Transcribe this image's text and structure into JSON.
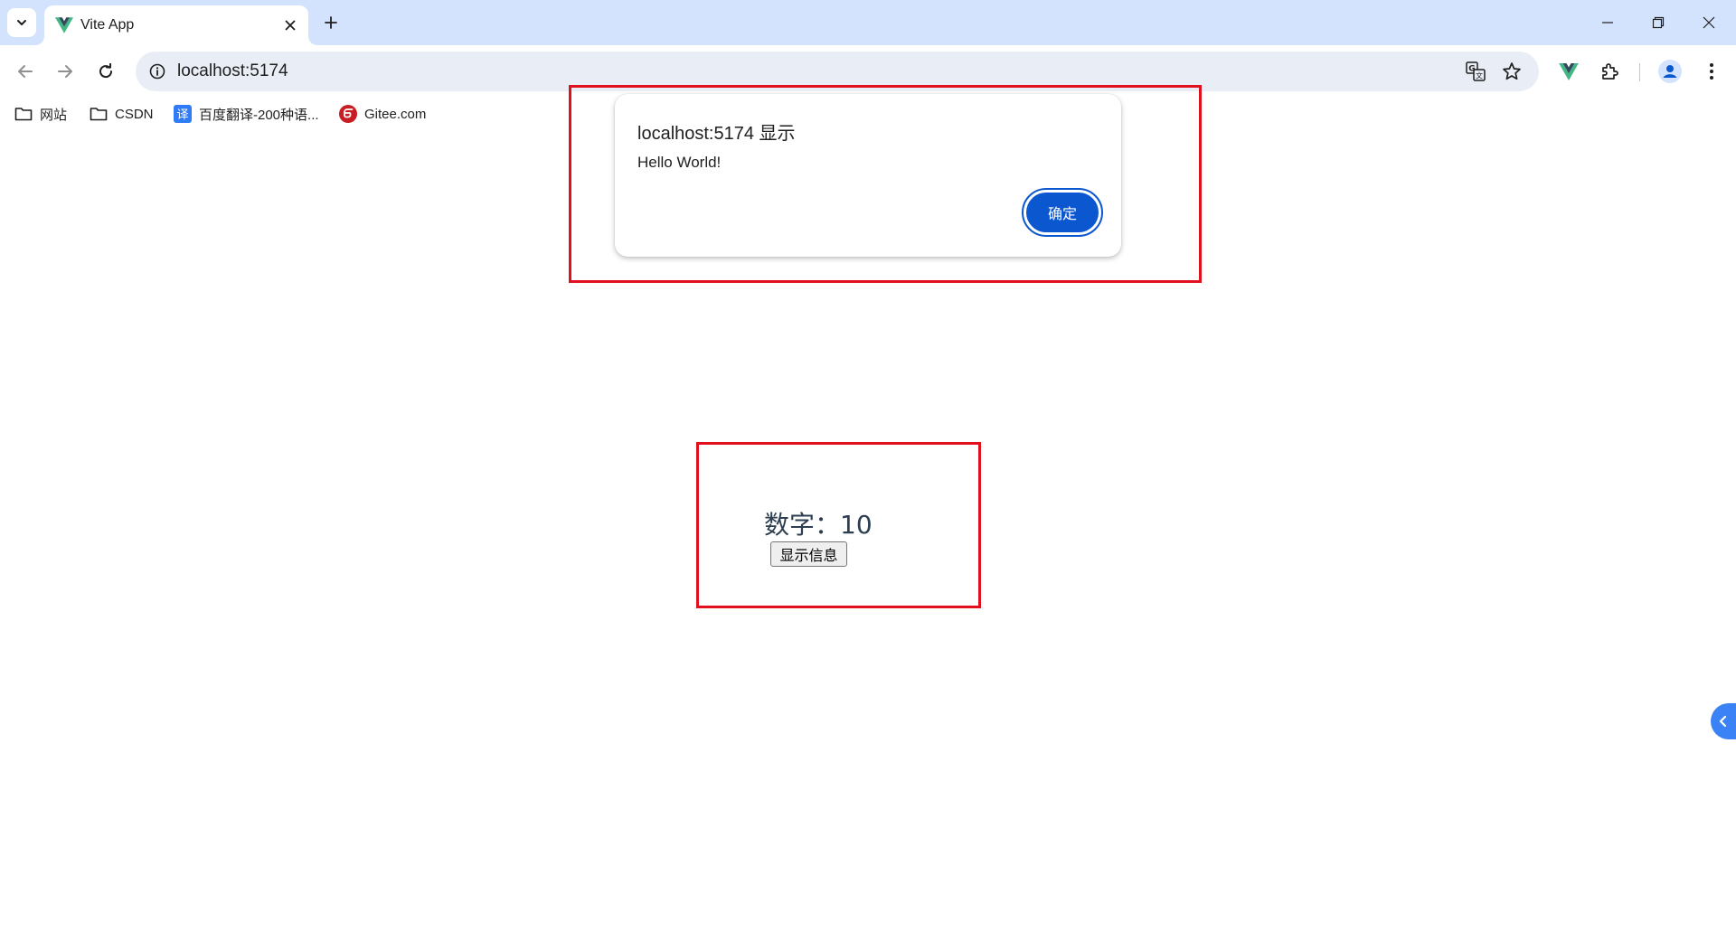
{
  "browser": {
    "tab": {
      "title": "Vite App",
      "favicon": "vue-logo-icon"
    },
    "url": "localhost:5174",
    "bookmarks": [
      {
        "label": "网站",
        "icon": "folder-icon"
      },
      {
        "label": "CSDN",
        "icon": "folder-icon"
      },
      {
        "label": "百度翻译-200种语...",
        "icon": "baidu-translate-icon"
      },
      {
        "label": "Gitee.com",
        "icon": "gitee-icon"
      }
    ]
  },
  "dialog": {
    "title": "localhost:5174 显示",
    "message": "Hello World!",
    "ok_label": "确定"
  },
  "app": {
    "number_label": "数字：",
    "number_value": "10",
    "button_label": "显示信息"
  },
  "colors": {
    "accent": "#0b57d0",
    "tabstrip": "#d3e3fd",
    "annotation": "#e0101e",
    "vue_green": "#41b883"
  }
}
